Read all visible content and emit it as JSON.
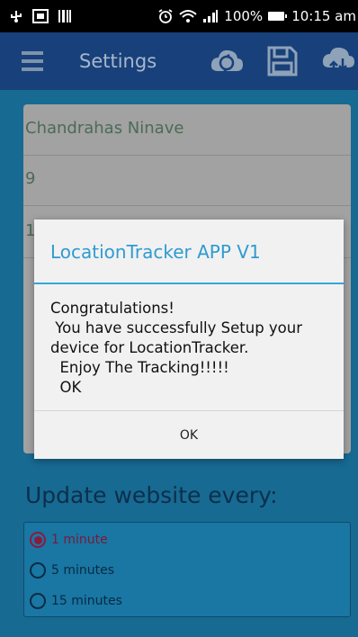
{
  "status_bar": {
    "battery": "100%",
    "time": "10:15 am"
  },
  "toolbar": {
    "title": "Settings"
  },
  "form": {
    "name_value": "Chandrahas Ninave",
    "number_value": "9",
    "field_three_value": "1"
  },
  "update": {
    "label": "Update website every:",
    "options": [
      "1 minute",
      "5 minutes",
      "15 minutes"
    ],
    "selected": "1 minute"
  },
  "dialog": {
    "title": "LocationTracker APP V1",
    "message": "Congratulations!\n You have successfully Setup your device for LocationTracker.\n  Enjoy The Tracking!!!!!\n  OK",
    "ok_label": "OK"
  },
  "colors": {
    "background": "#1c85b7",
    "toolbar": "#18407a",
    "accent": "#2f9bd0",
    "radio_checked": "#8a1b3e"
  }
}
